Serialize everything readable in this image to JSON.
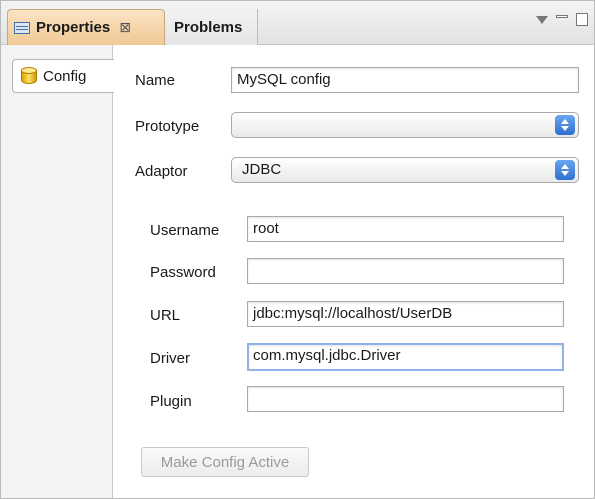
{
  "tabs": {
    "properties": "Properties",
    "problems": "Problems",
    "close_glyph": "⊠"
  },
  "sidebar": {
    "items": [
      {
        "label": "Config",
        "icon": "database-icon"
      }
    ]
  },
  "form": {
    "name_label": "Name",
    "name_value": "MySQL config",
    "prototype_label": "Prototype",
    "prototype_value": "",
    "adaptor_label": "Adaptor",
    "adaptor_value": "JDBC",
    "username_label": "Username",
    "username_value": "root",
    "password_label": "Password",
    "password_value": "",
    "url_label": "URL",
    "url_value": "jdbc:mysql://localhost/UserDB",
    "driver_label": "Driver",
    "driver_value": "com.mysql.jdbc.Driver",
    "plugin_label": "Plugin",
    "plugin_value": "",
    "make_active_label": "Make Config Active"
  },
  "colors": {
    "active_tab": "#f0c896",
    "focus_ring": "#8fb3e8",
    "select_arrow": "#2f6fd0"
  }
}
